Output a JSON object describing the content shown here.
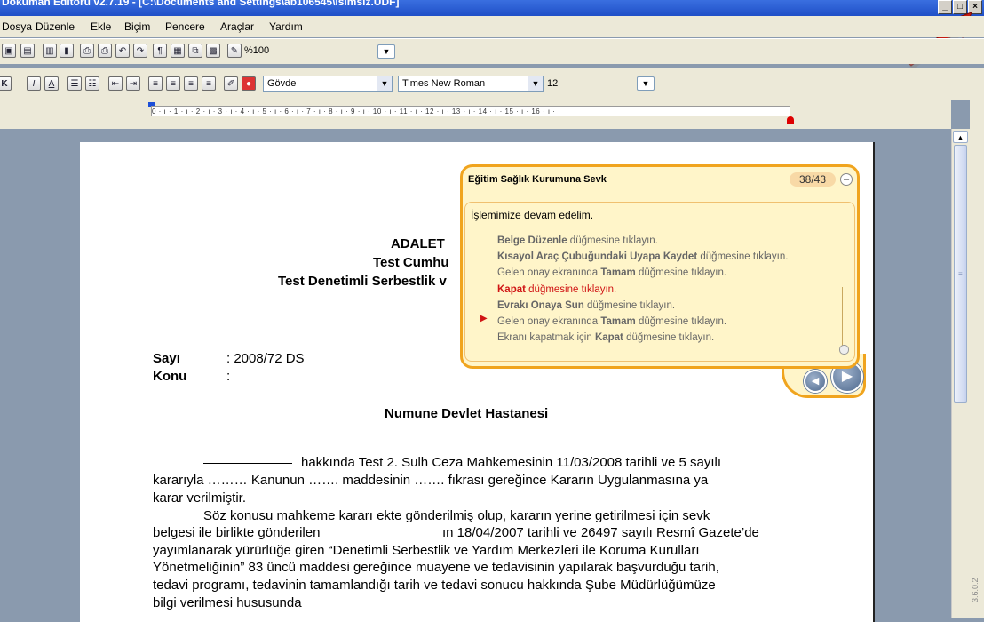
{
  "window": {
    "title": "Doküman Editörü v2.7.19 - [C:\\Documents and Settings\\ab106545\\İsimsiz.UDF]",
    "controls": [
      "_",
      "□",
      "×"
    ]
  },
  "menu": {
    "items": [
      "Dosya",
      "Düzenle",
      "Ekle",
      "Biçim",
      "Pencere",
      "Araçlar",
      "Yardım"
    ]
  },
  "toolbar1": {
    "zoom": "%100"
  },
  "toolbar2": {
    "style_value": "Gövde",
    "font_value": "Times New Roman",
    "size_value": "12"
  },
  "ruler": {
    "text": "0 · ı · 1 · ı · 2 · ı · 3 · ı · 4 · ı · 5 · ı · 6 · ı · 7 · ı · 8 · ı · 9 · ı · 10 · ı · 11 · ı · 12 · ı · 13 · ı · 14 · ı · 15 · ı · 16 · ı ·"
  },
  "document": {
    "header_line1": "ADALET",
    "header_line2": "Test Cumhu",
    "header_line3": "Test Denetimli Serbestlik v",
    "sayi_label": "Sayı",
    "sayi_value": ": 2008/72 DS",
    "konu_label": "Konu",
    "konu_value": ":",
    "recipient": "Numune Devlet Hastanesi",
    "para1_line1": "hakkında Test 2. Sulh Ceza Mahkemesinin 11/03/2008 tarihli ve 5 sayılı",
    "para1_line2": "kararıyla ……… Kanunun ……. maddesinin ……. fıkrası gereğince Kararın Uygulanmasına ya",
    "para1_line3": "karar verilmiştir.",
    "para2_line1": "Söz konusu mahkeme kararı ekte gönderilmiş olup, kararın yerine getirilmesi için sevk",
    "para2_line2a": "belgesi ile birlikte gönderilen",
    "para2_line2b": "ın 18/04/2007 tarihli ve 26497 sayılı Resmî Gazete’de",
    "para2_line3": "yayımlanarak yürürlüğe giren “Denetimli Serbestlik ve Yardım Merkezleri ile Koruma Kurulları",
    "para2_line4": "Yönetmeliğinin” 83 üncü maddesi gereğince muayene ve tedavisinin yapılarak başvurduğu tarih,",
    "para2_line5": "tedavi programı, tedavinin tamamlandığı tarih ve tedavi sonucu hakkında Şube Müdürlüğümüze",
    "para2_line6": "bilgi verilmesi hususunda"
  },
  "guide": {
    "title": "Eğitim Sağlık Kurumuna Sevk",
    "counter": "38/43",
    "minimize": "–",
    "intro": "İşlemimize devam edelim.",
    "steps": [
      {
        "bold": "Belge Düzenle",
        "rest": " düğmesine tıklayın."
      },
      {
        "bold": "Kısayol Araç Çubuğundaki Uyapa Kaydet",
        "rest": " düğmesine tıklayın."
      },
      {
        "pre": "Gelen onay ekranında ",
        "bold": "Tamam",
        "rest": " düğmesine tıklayın."
      },
      {
        "bold": "Kapat",
        "rest": " düğmesine tıklayın."
      },
      {
        "bold": "Evrakı Onaya Sun",
        "rest": " düğmesine tıklayın."
      },
      {
        "pre": "Gelen onay ekranında ",
        "bold": "Tamam",
        "rest": " düğmesine tıklayın."
      },
      {
        "pre": "Ekranı kapatmak için ",
        "bold": "Kapat",
        "rest": " düğmesine tıklayın."
      }
    ],
    "active_step": 3
  },
  "version": "3.6.0.2",
  "colors": {
    "accent_orange": "#f0a41e",
    "highlight_red": "#d01414",
    "titlebar_blue": "#1f4fc7"
  }
}
